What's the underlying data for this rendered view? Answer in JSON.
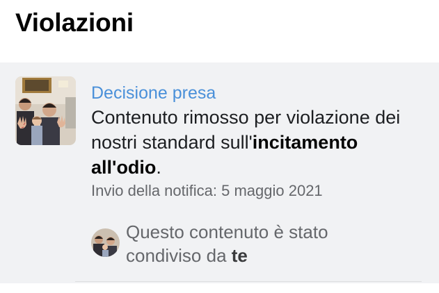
{
  "header": {
    "title": "Violazioni"
  },
  "violation": {
    "status": "Decisione presa",
    "message_part1": "Contenuto rimosso per violazione dei nostri standard sull'",
    "message_bold": "incitamento all'odio",
    "message_part2": ".",
    "sent_date": "Invio della notifica: 5 maggio 2021",
    "shared_by_prefix": "Questo contenuto è stato condiviso da ",
    "shared_by_user": "te"
  }
}
